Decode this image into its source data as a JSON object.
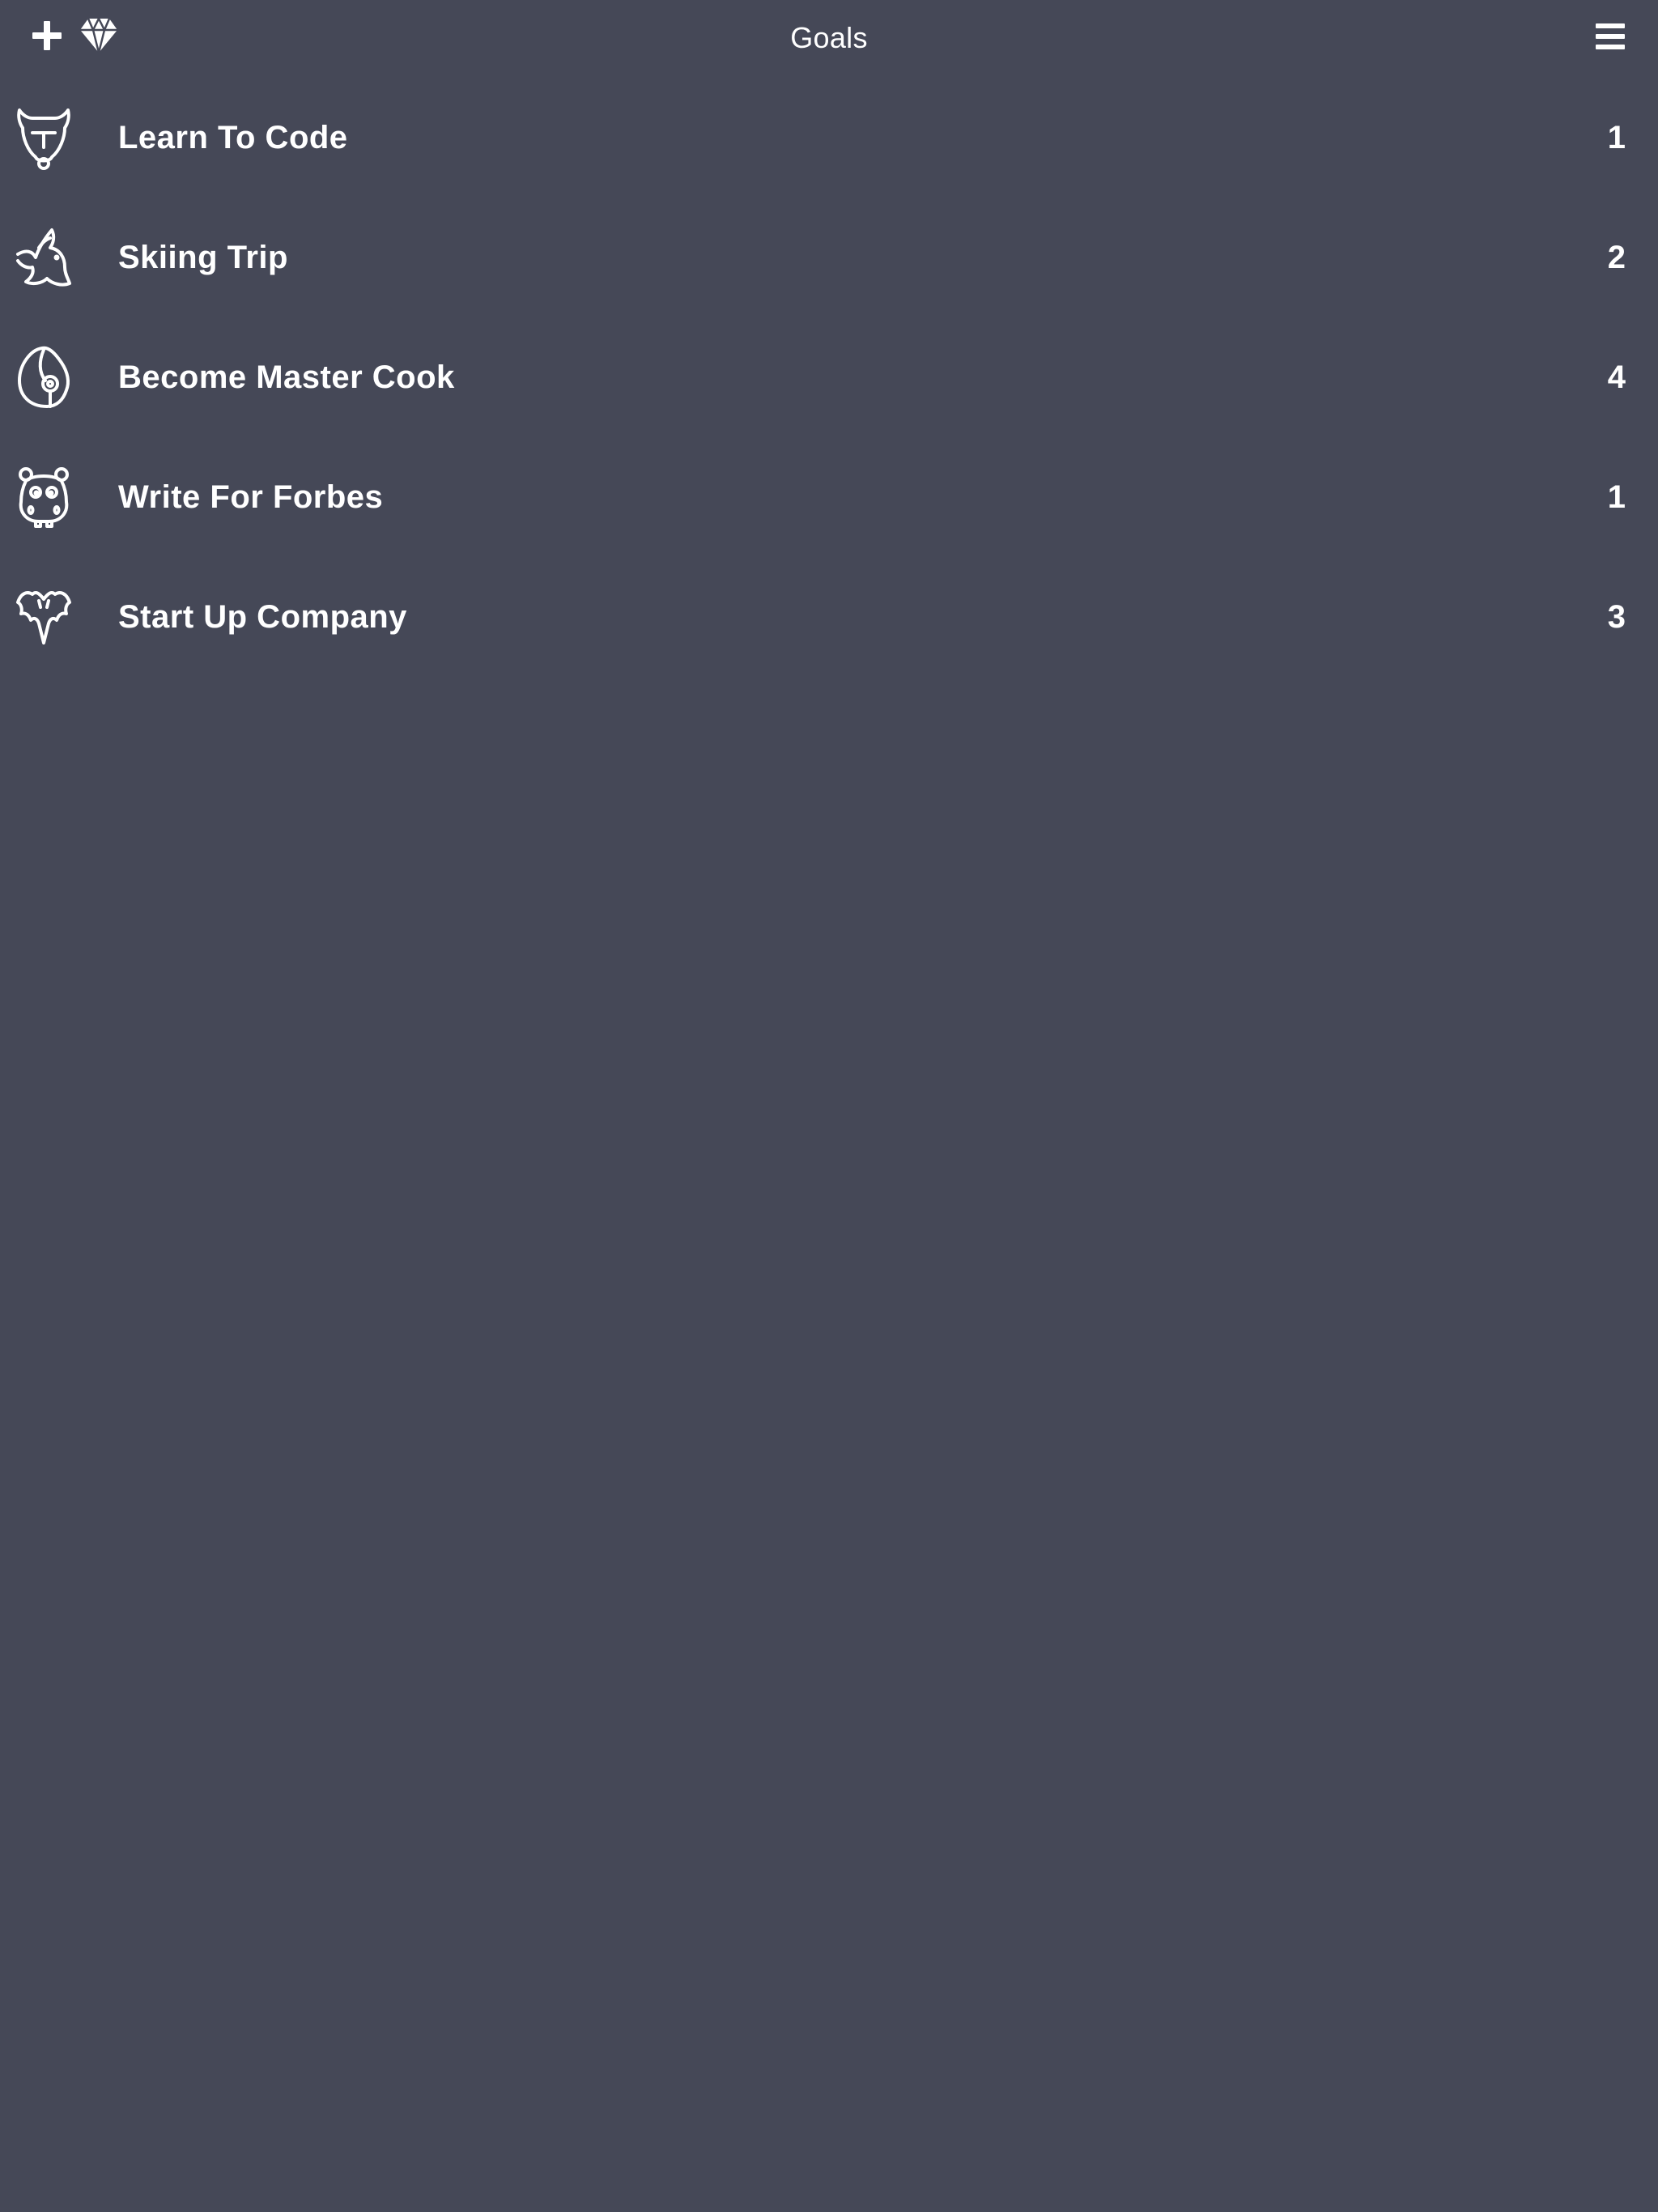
{
  "nav": {
    "title": "Goals",
    "add_icon": "plus-icon",
    "premium_icon": "diamond-icon",
    "menu_icon": "hamburger-menu-icon"
  },
  "goals": [
    {
      "title": "Learn To Code",
      "count": "1",
      "icon": "camel-icon"
    },
    {
      "title": "Skiing Trip",
      "count": "2",
      "icon": "dove-icon"
    },
    {
      "title": "Become Master Cook",
      "count": "4",
      "icon": "snail-shell-icon"
    },
    {
      "title": "Write For Forbes",
      "count": "1",
      "icon": "hippo-icon"
    },
    {
      "title": "Start Up Company",
      "count": "3",
      "icon": "bat-icon"
    }
  ],
  "colors": {
    "background": "#454857",
    "foreground": "#ffffff"
  }
}
